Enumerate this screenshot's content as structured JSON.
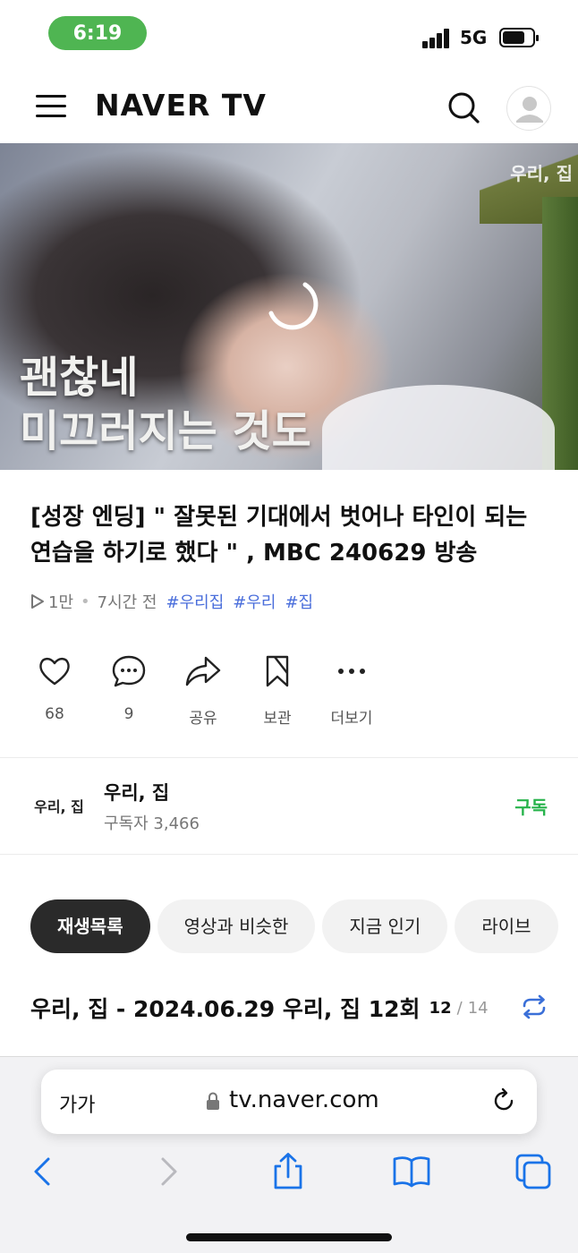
{
  "status_bar": {
    "time": "6:19",
    "network": "5G"
  },
  "header": {
    "logo": "NAVER TV"
  },
  "video": {
    "channel_watermark": "우리, 집",
    "caption_line1": "괜찮네",
    "caption_line2": "미끄러지는 것도"
  },
  "title": "[성장 엔딩] \" 잘못된 기대에서 벗어나 타인이 되는 연습을 하기로 했다 \" , MBC 240629 방송",
  "meta": {
    "views": "1만",
    "time_ago": "7시간 전",
    "tags": [
      "#우리집",
      "#우리",
      "#집"
    ]
  },
  "actions": [
    {
      "label": "68",
      "icon": "heart-icon"
    },
    {
      "label": "9",
      "icon": "comment-icon"
    },
    {
      "label": "공유",
      "icon": "share-icon"
    },
    {
      "label": "보관",
      "icon": "bookmark-icon"
    },
    {
      "label": "더보기",
      "icon": "more-icon"
    }
  ],
  "channel": {
    "logo_text": "우리, 집",
    "name": "우리, 집",
    "subscribers": "구독자 3,466",
    "subscribe_label": "구독"
  },
  "chips": [
    "재생목록",
    "영상과 비슷한",
    "지금 인기",
    "라이브"
  ],
  "playlist": {
    "title": "우리, 집 - 2024.06.29 우리, 집 12회",
    "current": "12",
    "separator": "/",
    "total": "14"
  },
  "browser": {
    "text_size_label": "가가",
    "url": "tv.naver.com"
  },
  "colors": {
    "accent_green": "#27b34b",
    "tag_blue": "#4a6edb",
    "status_green": "#4fb552",
    "ios_blue": "#1a73e8"
  }
}
